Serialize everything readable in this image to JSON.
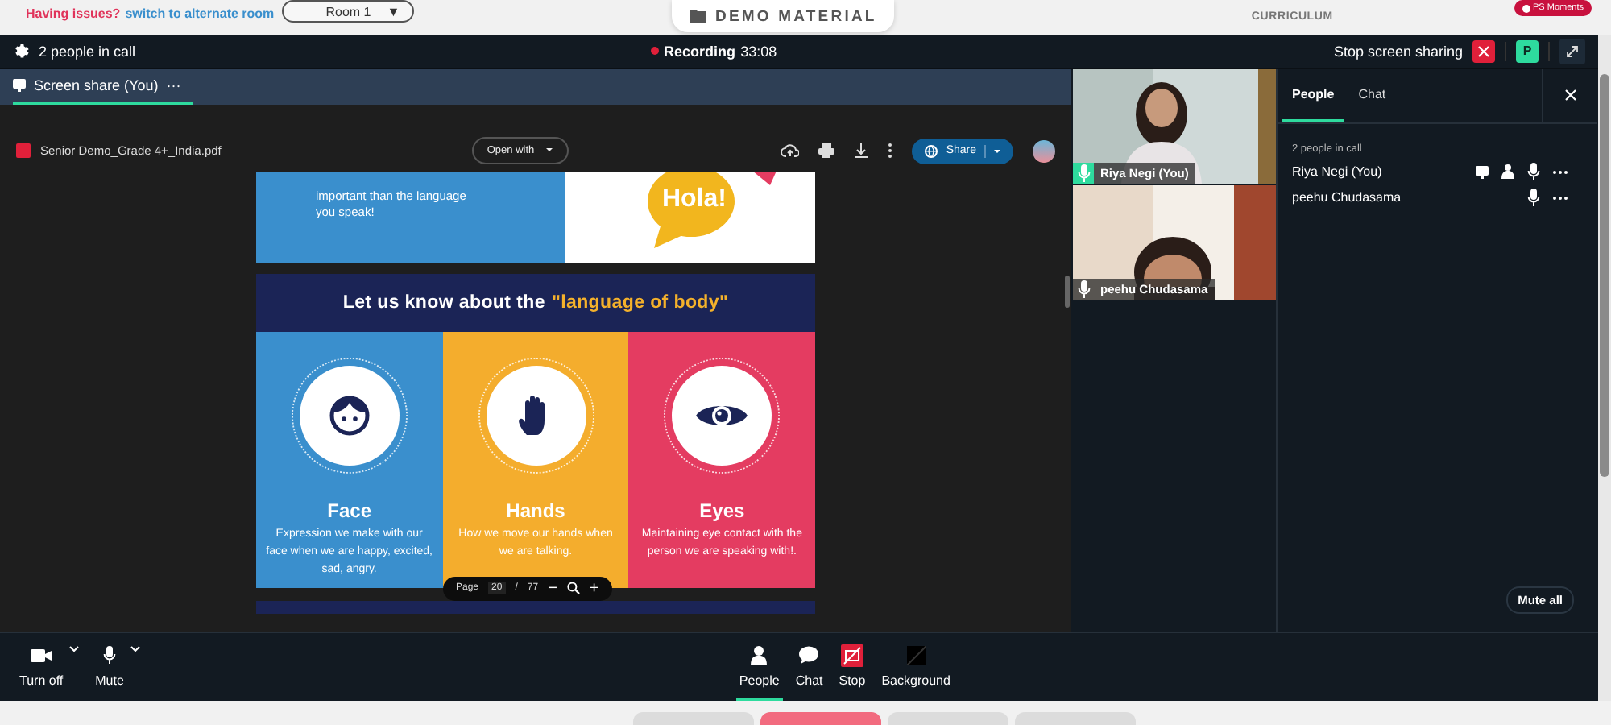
{
  "notice": {
    "warning": "Having issues?",
    "link": "switch to alternate room"
  },
  "room_select": {
    "value": "Room 1",
    "arrow": "▼"
  },
  "top_tabs": [
    {
      "label": "DEMO MATERIAL",
      "selected": true
    },
    {
      "label": "CURRICULUM",
      "selected": false
    }
  ],
  "badge": "PS Moments",
  "header": {
    "people_count": "2 people in call",
    "recording": "Recording",
    "recording_time": "33:08",
    "stop_sharing": "Stop screen sharing",
    "avatar_letter": "P"
  },
  "share_tab": {
    "label": "Screen share (You)",
    "more": "···",
    "selected": true
  },
  "pdf": {
    "filename": "Senior Demo_Grade 4+_India.pdf",
    "open_with": "Open with",
    "share": "Share",
    "slide": {
      "intro": "important than the language you speak!",
      "bubble": "Hola!",
      "heading": "Let us know about the",
      "heading_highlight": "\"language of body\"",
      "columns": [
        {
          "kind": "face",
          "title": "Face",
          "text": "Expression we make with our face when we are happy, excited, sad, angry.",
          "color": "#3a8fcd"
        },
        {
          "kind": "hands",
          "title": "Hands",
          "text": "How we move our hands when we are talking.",
          "color": "#f4ad2d"
        },
        {
          "kind": "eyes",
          "title": "Eyes",
          "text": "Maintaining eye contact with the person we are speaking with!.",
          "color": "#e43c61"
        }
      ]
    },
    "page_label": "Page",
    "page": "20",
    "page_sep": "/",
    "page_total": "77",
    "zoom_out": "−",
    "zoom_in": "+"
  },
  "videos": [
    {
      "name": "Riya Negi (You)",
      "speaking": true
    },
    {
      "name": "peehu Chudasama",
      "speaking": false
    }
  ],
  "panel": {
    "tabs": [
      {
        "label": "People",
        "selected": true
      },
      {
        "label": "Chat",
        "selected": false
      }
    ],
    "count": "2 people in call",
    "participants": [
      {
        "name": "Riya Negi (You)",
        "presenting": true
      },
      {
        "name": "peehu Chudasama",
        "presenting": false
      }
    ],
    "mute_all": "Mute all"
  },
  "toolbar": {
    "left": [
      {
        "kind": "camera",
        "label": "Turn off"
      },
      {
        "kind": "mic",
        "label": "Mute"
      }
    ],
    "center": [
      {
        "kind": "people",
        "label": "People",
        "selected": true
      },
      {
        "kind": "chat",
        "label": "Chat",
        "selected": false
      },
      {
        "kind": "stop",
        "label": "Stop",
        "selected": false
      },
      {
        "kind": "background",
        "label": "Background",
        "selected": false
      }
    ]
  }
}
